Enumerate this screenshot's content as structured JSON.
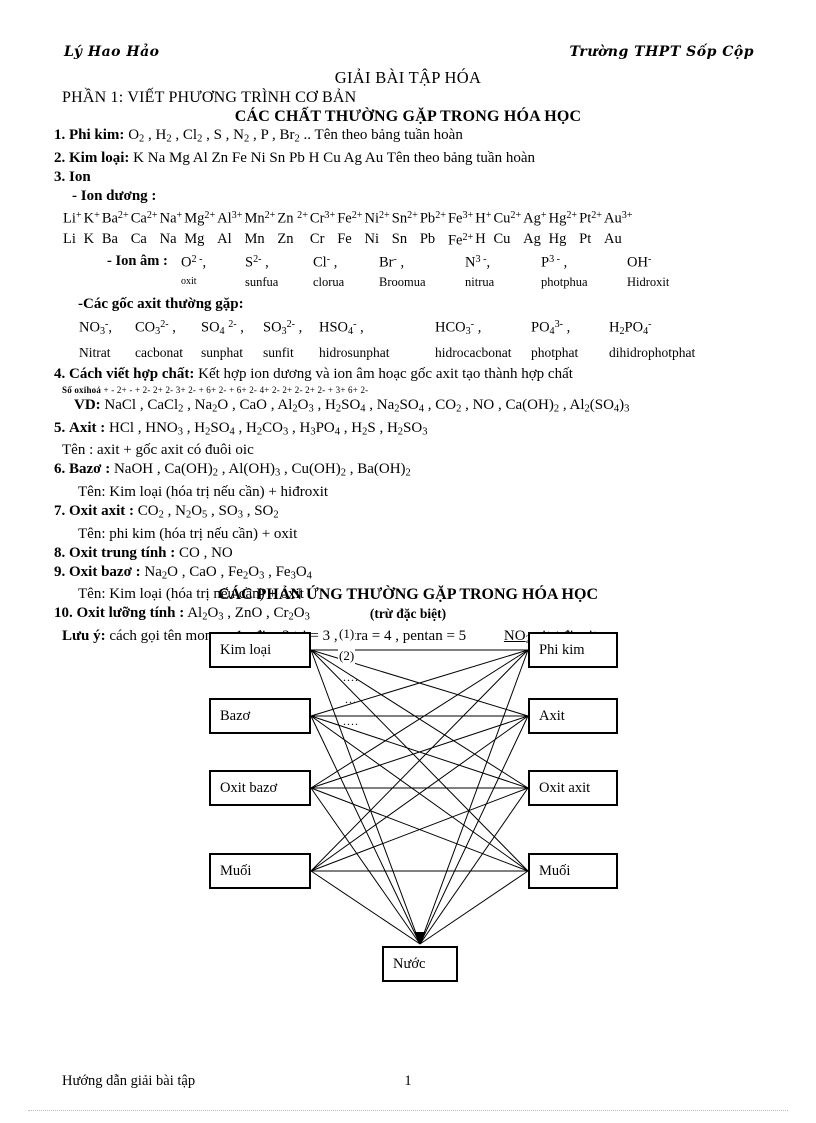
{
  "header": {
    "left": "Lý Hao Hảo",
    "right": "Trường THPT Sốp Cộp"
  },
  "titles": {
    "main": "GIẢI BÀI TẬP HÓA",
    "part": "PHẦN 1: VIẾT PHƯƠNG TRÌNH  CƠ BẢN",
    "sub": "CÁC CHẤT THƯỜNG GẶP TRONG HÓA HỌC"
  },
  "items": {
    "i1_num": "1.",
    "i1_label": "Phi kim:",
    "i1_text": "Tên theo bảng tuần  hoàn",
    "i1_formulas": [
      "O2",
      "H2",
      "Cl2",
      "S",
      "N2",
      "P",
      "Br2"
    ],
    "i1_tail": "..",
    "i2_num": "2.",
    "i2_label": "Kim loại:",
    "i2_list": "K Na  Mg Al Zn Fe Ni Sn Pb H Cu  Ag Au",
    "i2_text": "Tên theo bảng tuần  hoàn",
    "i3_num": "3.",
    "i3_label": "Ion",
    "cation_heading": "- Ion dương :",
    "anion_heading": "- Ion âm :",
    "acid_heading": "-Các gốc axit thường gặp:",
    "i4_num": "4.",
    "i4_label": "Cách viết hợp chất:",
    "i4_text": "Kết hợp ion  dương và ion âm hoạc gốc axit tạo thành hợp chất",
    "oxi_label": "Số oxihoá",
    "oxi_values": "+    -     2+     -     +    2-    2+ 2-    3+ 2-    + 6+ 2-     + 6+ 2-   4+ 2-   2+ 2-   2+ 2- +       3+ 6+ 2-",
    "vd_label": "VD:",
    "vd_text": "NaCl , CaCl2 , Na2O , CaO , Al2O3 , H2SO4 , Na2SO4 , CO2 , NO , Ca(OH)2 , Al2(SO4)3",
    "i5_num": "5.",
    "i5_label": "Axit :",
    "i5_text": "HCl  , HNO3 , H2SO4 , H2CO3 , H3PO4 , H2S , H2SO3",
    "i5_name": "Tên   :  axit  +   gốc axit có đuôi oic",
    "i6_num": "6.",
    "i6_label": "Bazơ :",
    "i6_text": "NaOH , Ca(OH)2 , Al(OH)3 , Cu(OH)2 , Ba(OH)2",
    "i6_name": "Tên:   Kim  loại (hóa trị nếu  cần) + hiđroxit",
    "i7_num": "7.",
    "i7_label": "Oxit axit :",
    "i7_text": "CO2 , N2O5 , SO3 , SO2",
    "i7_name": "Tên:   phi kim (hóa trị nếu cần) + oxit",
    "i8_num": "8.",
    "i8_label": "Oxit trung tính :",
    "i8_text": "CO , NO",
    "i9_num": "9.",
    "i9_label": "Oxit bazơ :",
    "i9_text": "Na2O , CaO , Fe2O3 , Fe3O4",
    "i9_name": "Tên:   Kim  loại (hóa trị nếu cần) + oxit",
    "i10_num": "10.",
    "i10_label": "Oxit lưỡng tính :",
    "i10_text": "Al2O3 , ZnO , Cr2O3",
    "note_label": "Lưu ý:",
    "note_text": "cách gọi tên mono = 1 , đi = 2    tri = 3  , tetra = 4 , pentan = 5",
    "note_extra": "NO2 nitơ đioxit"
  },
  "cations": {
    "row_ions": [
      "Li+",
      "K+",
      "Ba2+",
      "Ca2+",
      "Na+",
      "Mg2+",
      "Al3+",
      "Mn2+",
      "Zn 2+",
      "Cr3+",
      "Fe2+",
      "Ni2+",
      "Sn2+",
      "Pb2+",
      "Fe3+",
      "H+",
      "Cu2+",
      "Ag+",
      "Hg2+",
      "Pt2+",
      "Au3+"
    ],
    "row_names": [
      "Li",
      "K",
      "Ba",
      "Ca",
      "Na",
      "Mg",
      "Al",
      "Mn",
      "Zn",
      "Cr",
      "Fe",
      "Ni",
      "Sn",
      "Pb",
      "Fe2+",
      "H",
      "Cu",
      "Ag",
      "Hg",
      "Pt",
      "Au"
    ]
  },
  "anions": {
    "ions": [
      "O2-",
      "S2-",
      "Cl-",
      "Br-",
      "N3-",
      "P3-",
      "OH-"
    ],
    "names": [
      "oxit",
      "sunfua",
      "clorua",
      "Broomua",
      "nitrua",
      "photphua",
      "Hidroxit"
    ]
  },
  "acid_radicals": {
    "ions": [
      "NO3-",
      "CO32-",
      "SO42-",
      "SO32-",
      "HSO4-",
      "HCO3-",
      "PO43-",
      "H2PO4-"
    ],
    "names": [
      "Nitrat",
      "cacbonat",
      "sunphat",
      "sunfit",
      "hidrosunphat",
      "hidrocacbonat",
      "photphat",
      "dihidrophotphat"
    ]
  },
  "diagram": {
    "title": "CÁC PHẢN ỨNG THƯỜNG GẶP TRONG HÓA HỌC",
    "subtitle": "(trừ đặc biệt)",
    "nodes": [
      {
        "id": "kim-loai",
        "label": "Kim loại"
      },
      {
        "id": "phi-kim",
        "label": "Phi kim"
      },
      {
        "id": "bazo",
        "label": "Bazơ"
      },
      {
        "id": "axit",
        "label": "Axit"
      },
      {
        "id": "oxit-bazo",
        "label": "Oxit bazơ"
      },
      {
        "id": "oxit-axit",
        "label": "Oxit axit"
      },
      {
        "id": "muoi-trai",
        "label": "Muối"
      },
      {
        "id": "muoi-phai",
        "label": "Muối"
      },
      {
        "id": "nuoc",
        "label": "Nước"
      }
    ],
    "edge_labels": [
      "(1)",
      "(2)"
    ],
    "dots": [
      "....",
      "...",
      "...."
    ]
  },
  "footer": {
    "left": "Hướng dẫn giải bài tập",
    "page": "1"
  }
}
